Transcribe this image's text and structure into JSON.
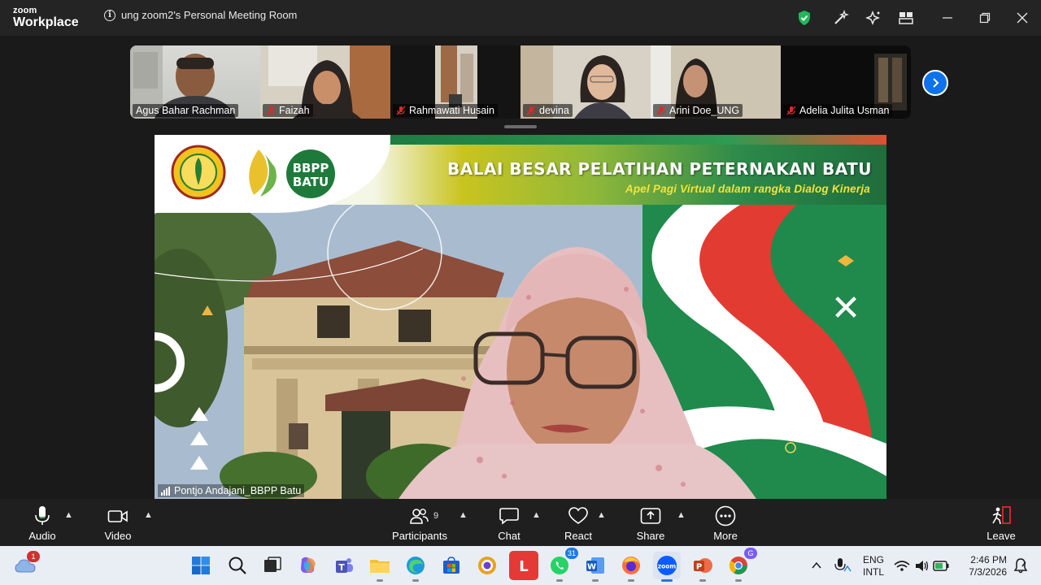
{
  "app": {
    "brand_top": "zoom",
    "brand_bottom": "Workplace",
    "meeting_title": "ung zoom2's Personal Meeting Room"
  },
  "participants": [
    {
      "name": "Agus Bahar Rachman",
      "muted": false
    },
    {
      "name": "Faizah",
      "muted": true
    },
    {
      "name": "Rahmawati Husain",
      "muted": true
    },
    {
      "name": "devina",
      "muted": true
    },
    {
      "name": "Arini Doe_UNG",
      "muted": true
    },
    {
      "name": "Adelia Julita Usman",
      "muted": true
    }
  ],
  "main_video": {
    "speaker": "Pontjo Andajani_BBPP Batu",
    "logo_text_1": "BBPP",
    "logo_text_2": "BATU",
    "banner_title": "BALAI BESAR PELATIHAN PETERNAKAN BATU",
    "banner_subtitle": "Apel Pagi Virtual dalam rangka Dialog Kinerja"
  },
  "toolbar": {
    "audio": "Audio",
    "video": "Video",
    "participants": "Participants",
    "participants_count": "9",
    "chat": "Chat",
    "react": "React",
    "share": "Share",
    "more": "More",
    "leave": "Leave"
  },
  "taskbar": {
    "weather_badge": "1",
    "whatsapp_badge": "31",
    "chrome_badge": "G",
    "lang_1": "ENG",
    "lang_2": "INTL",
    "time": "2:46 PM",
    "date": "7/3/2026"
  },
  "colors": {
    "zoom_blue": "#0e72ed",
    "muted_red": "#e02828",
    "shield_green": "#1fb85a",
    "leave_red": "#e02828"
  }
}
